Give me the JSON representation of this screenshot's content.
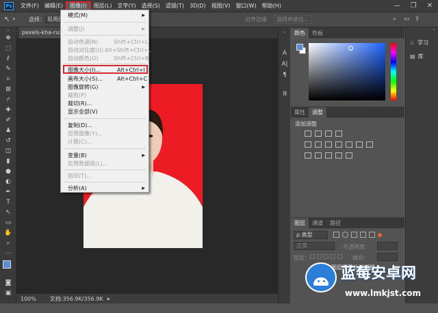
{
  "app_badge": "Ps",
  "menubar": [
    "文件(F)",
    "编辑(E)",
    "图像(I)",
    "图层(L)",
    "文字(Y)",
    "选择(S)",
    "滤镜(T)",
    "3D(D)",
    "视图(V)",
    "窗口(W)",
    "帮助(H)"
  ],
  "options": {
    "select_label": "选择：",
    "current_label": "现用图",
    "align_edge": "对齐边缘",
    "select_mask": "选择并遮住..."
  },
  "document": {
    "tab_title": "pexels-kha-ruxury"
  },
  "image_menu": [
    {
      "label": "模式(M)",
      "submenu": true,
      "disabled": false
    },
    {
      "label": "调整(J)",
      "submenu": true,
      "disabled": true
    },
    {
      "label": "自动色调(N)",
      "shortcut": "Shift+Ctrl+L",
      "disabled": true
    },
    {
      "label": "自动对比度(U)",
      "shortcut": "Alt+Shift+Ctrl+L",
      "disabled": true
    },
    {
      "label": "自动颜色(O)",
      "shortcut": "Shift+Ctrl+B",
      "disabled": true
    },
    {
      "label": "图像大小(I)...",
      "shortcut": "Alt+Ctrl+I",
      "disabled": false
    },
    {
      "label": "画布大小(S)...",
      "shortcut": "Alt+Ctrl+C",
      "disabled": false
    },
    {
      "label": "图像旋转(G)",
      "submenu": true,
      "disabled": false
    },
    {
      "label": "裁剪(P)",
      "disabled": true
    },
    {
      "label": "裁切(R)...",
      "disabled": false
    },
    {
      "label": "显示全部(V)",
      "disabled": false
    },
    {
      "label": "复制(D)...",
      "disabled": false
    },
    {
      "label": "应用图像(Y)...",
      "disabled": true
    },
    {
      "label": "计算(C)...",
      "disabled": true
    },
    {
      "label": "变量(B)",
      "submenu": true,
      "disabled": false
    },
    {
      "label": "应用数据组(L)...",
      "disabled": true
    },
    {
      "label": "陷印(T)...",
      "disabled": true
    },
    {
      "label": "分析(A)",
      "submenu": true,
      "disabled": false
    }
  ],
  "color_panel": {
    "tabs": [
      "颜色",
      "色板"
    ],
    "fg_color": "#5b8ed6",
    "bg_color": "#ffffff",
    "hue": "#1e64ff"
  },
  "adjust_panel": {
    "tabs": [
      "属性",
      "调整"
    ],
    "label": "添加调整"
  },
  "layers_panel": {
    "tabs": [
      "图层",
      "通道",
      "路径"
    ],
    "kind_label": "ρ 类型",
    "blend_mode": "正常",
    "opacity_label": "不透明度：",
    "lock_label": "锁定：",
    "fill_label": "填充：",
    "empty_message": "没有图层匹配此过滤器"
  },
  "learn_panel": {
    "learn": "学习",
    "library": "库"
  },
  "status": {
    "zoom": "100%",
    "doc_size": "文档:356.9K/356.9K"
  },
  "watermark": {
    "name": "蓝莓安卓网",
    "url": "www.lmkjst.com"
  }
}
